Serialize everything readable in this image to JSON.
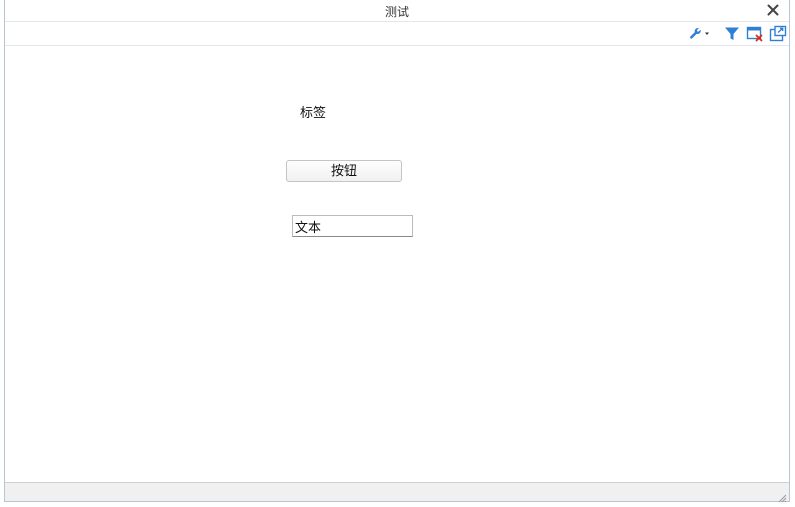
{
  "window": {
    "title": "测试"
  },
  "toolbar": {
    "icons": [
      "wrench-dropdown-icon",
      "filter-icon",
      "clear-window-icon",
      "popout-icon"
    ]
  },
  "form": {
    "label_text": "标签",
    "button_label": "按钮",
    "textbox_value": "文本"
  },
  "colors": {
    "accent_blue": "#2f7fd6",
    "close_red": "#d9281e"
  }
}
